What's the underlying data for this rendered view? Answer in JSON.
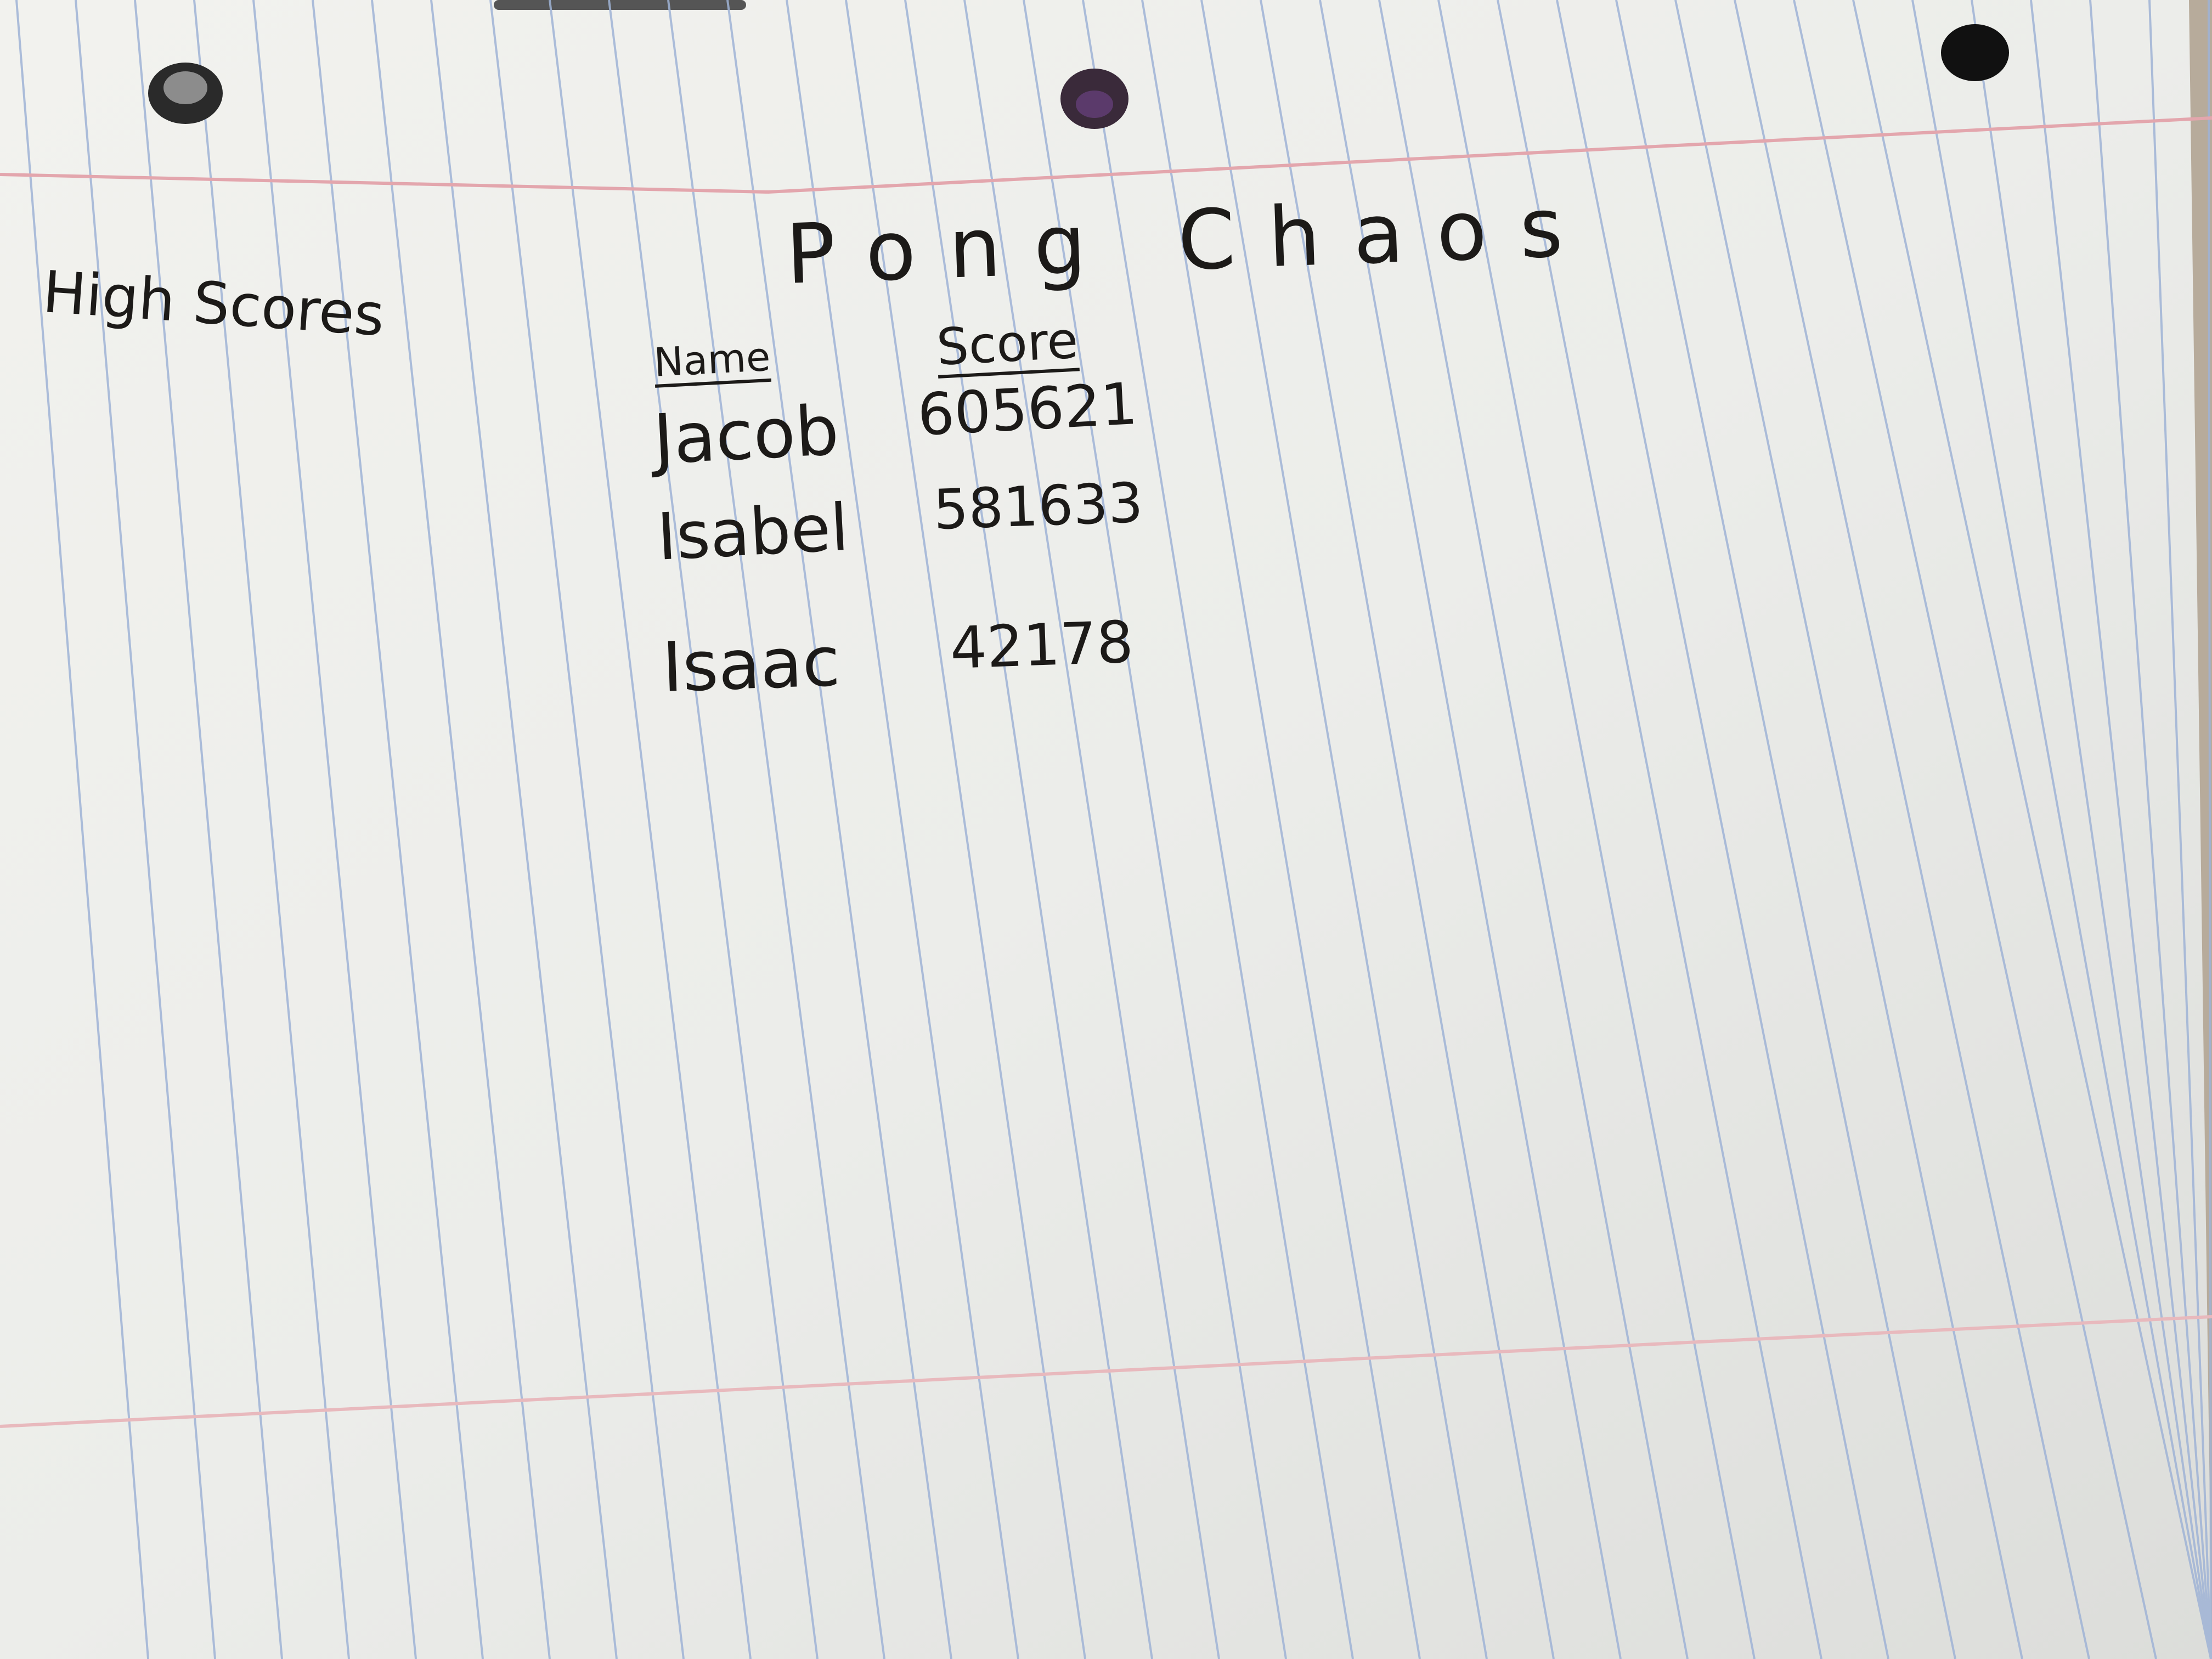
{
  "notes": {
    "side_label": "High Scores",
    "title": "Pong Chaos",
    "headers": {
      "name": "Name",
      "score": "Score"
    },
    "rows": [
      {
        "name": "Jacob",
        "score": "605621"
      },
      {
        "name": "Isabel",
        "score": "581633"
      },
      {
        "name": "Isaac",
        "score": "42178"
      }
    ]
  },
  "colors": {
    "paper": "#eeeeea",
    "ruled_line": "#9fb3d6",
    "margin_line": "#e3a6ad",
    "ink": "#1c1a18",
    "background": "#b7ab9b"
  }
}
